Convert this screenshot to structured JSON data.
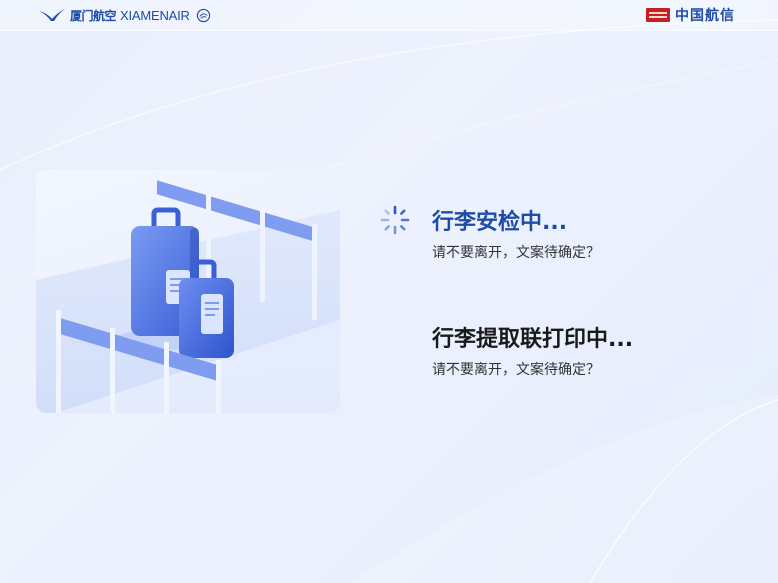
{
  "header": {
    "left_brand_cn": "厦门航空",
    "left_brand_en": "XIAMENAIR",
    "right_brand_cn": "中国航信"
  },
  "colors": {
    "brand_blue": "#1f4ba8",
    "spinner_blue": "#2b57c9",
    "badge_red": "#c8201f",
    "background": "#e9effd"
  },
  "statuses": [
    {
      "title": "行李安检中...",
      "subtitle": "请不要离开，文案待确定？",
      "state": "in-progress",
      "icon": "loading-spinner-icon"
    },
    {
      "title": "行李提取联打印中...",
      "subtitle": "请不要离开，文案待确定？",
      "state": "pending"
    }
  ],
  "illustration": {
    "icon": "luggage-icon"
  }
}
